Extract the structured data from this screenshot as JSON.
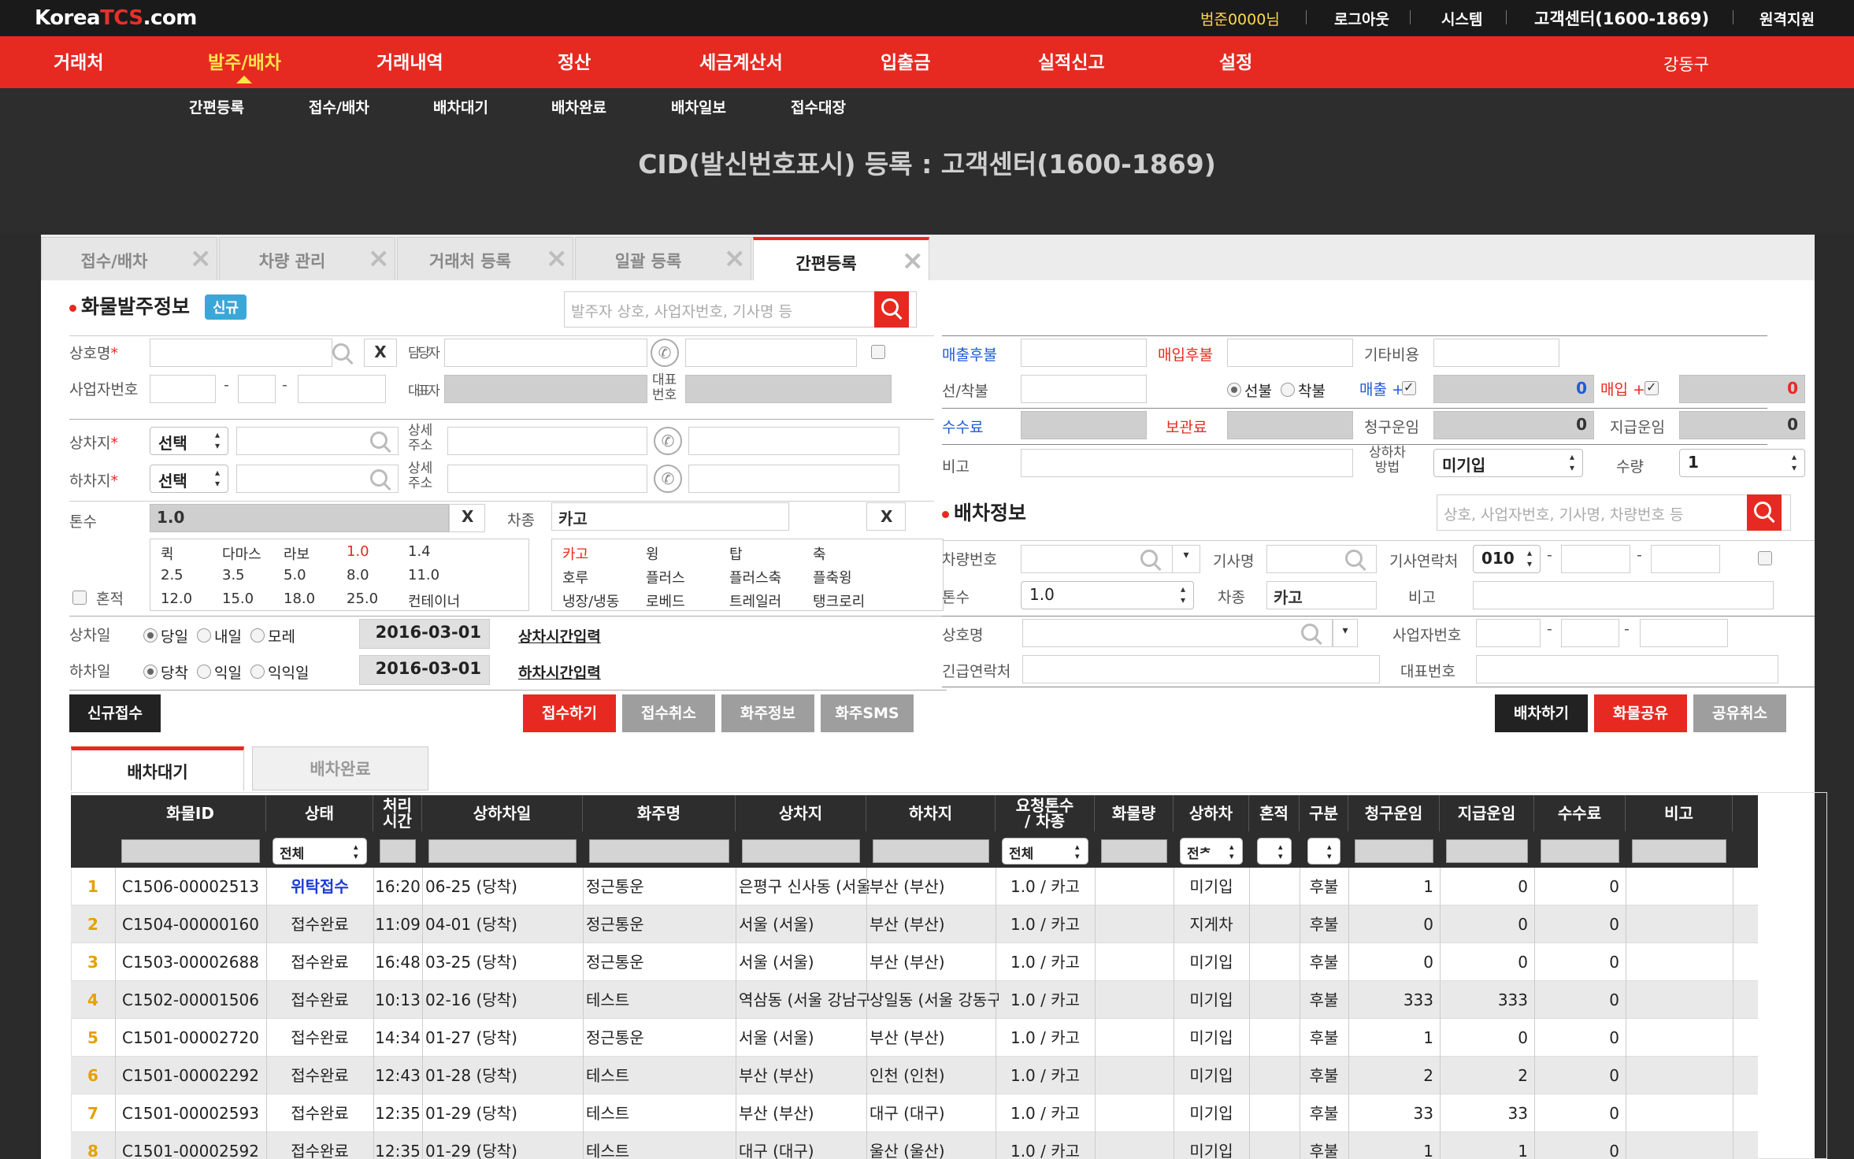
{
  "topbar": {
    "logo_prefix": "Korea",
    "logo_tcs": "TCS",
    "logo_suffix": ".com",
    "user": "범준0000님",
    "logout": "로그아웃",
    "system": "시스템",
    "support_center": "고객센터(1600-1869)",
    "remote": "원격지원"
  },
  "nav": {
    "items": [
      "거래처",
      "발주/배차",
      "거래내역",
      "정산",
      "세금계산서",
      "입출금",
      "실적신고",
      "설정"
    ],
    "region": "강동구"
  },
  "subnav": {
    "items": [
      "간편등록",
      "접수/배차",
      "배차대기",
      "배차완료",
      "배차일보",
      "접수대장"
    ],
    "page_title": "CID(발신번호표시) 등록 : 고객센터(1600-1869)"
  },
  "tabs": [
    {
      "label": "접수/배차"
    },
    {
      "label": "차량 관리"
    },
    {
      "label": "거래처 등록"
    },
    {
      "label": "일괄 등록"
    },
    {
      "label": "간편등록"
    }
  ],
  "order": {
    "title": "화물발주정보",
    "badge": "신규",
    "search_placeholder": "발주자 상호, 사업자번호, 기사명 등",
    "company_label": "상호명",
    "manager_label": "담당자",
    "bizno_label": "사업자번호",
    "ceo_label": "대표자",
    "rep_no_label": "대표\n번호",
    "load_label": "상차지",
    "unload_label": "하차지",
    "select": "선택",
    "detail_addr_label": "상세\n주소",
    "tonnage_label": "톤수",
    "tonnage_value": "1.0",
    "vehicle_label": "차종",
    "vehicle_value": "카고",
    "mixed_label": "혼적",
    "tonnage_options": [
      [
        "퀵",
        "다마스",
        "라보",
        "1.0",
        "1.4"
      ],
      [
        "2.5",
        "3.5",
        "5.0",
        "8.0",
        "11.0"
      ],
      [
        "12.0",
        "15.0",
        "18.0",
        "25.0",
        "컨테이너"
      ]
    ],
    "vehicle_options": [
      [
        "카고",
        "윙",
        "탑",
        "축"
      ],
      [
        "호루",
        "플러스",
        "플러스축",
        "플축윙"
      ],
      [
        "냉장/냉동",
        "로베드",
        "트레일러",
        "탱크로리"
      ]
    ],
    "load_date_label": "상차일",
    "load_day_options": [
      "당일",
      "내일",
      "모레"
    ],
    "load_date": "2016-03-01",
    "load_time_link": "상차시간입력",
    "unload_date_label": "하차일",
    "unload_day_options": [
      "당착",
      "익일",
      "익익일"
    ],
    "unload_date": "2016-03-01",
    "unload_time_link": "하차시간입력",
    "x": "X",
    "buttons": {
      "new": "신규접수",
      "submit": "접수하기",
      "cancel": "접수취소",
      "shipper_info": "화주정보",
      "shipper_sms": "화주SMS"
    }
  },
  "billing": {
    "sales_deferred": "매출후불",
    "purchase_deferred": "매입후불",
    "other_cost": "기타비용",
    "prepaid_label": "선/착불",
    "prepaid": "선불",
    "collect": "착불",
    "sales_plus": "매출 +",
    "sales_value": "0",
    "purchase_plus": "매입 +",
    "purchase_value": "0",
    "fee": "수수료",
    "storage_fee": "보관료",
    "claim_fare": "청구운임",
    "claim_value": "0",
    "pay_fare": "지급운임",
    "pay_value": "0",
    "note": "비고",
    "loading_method": "상하차\n방법",
    "loading_method_value": "미기입",
    "quantity": "수량",
    "quantity_value": "1"
  },
  "dispatch": {
    "title": "배차정보",
    "search_placeholder": "상호, 사업자번호, 기사명, 차량번호 등",
    "vehicle_no": "차량번호",
    "driver_name": "기사명",
    "driver_contact": "기사연락처",
    "phone_prefix": "010",
    "tonnage": "톤수",
    "tonnage_value": "1.0",
    "vehicle_type": "차종",
    "vehicle_value": "카고",
    "note": "비고",
    "company": "상호명",
    "bizno": "사업자번호",
    "emergency": "긴급연락처",
    "rep_no": "대표번호",
    "buttons": {
      "dispatch": "배차하기",
      "share": "화물공유",
      "unshare": "공유취소"
    }
  },
  "list": {
    "tabs": [
      "배차대기",
      "배차완료"
    ],
    "headers": [
      "화물ID",
      "상태",
      "처리\n시간",
      "상하차일",
      "화주명",
      "상차지",
      "하차지",
      "요청톤수\n/ 차종",
      "화물량",
      "상하차",
      "혼적",
      "구분",
      "청구운임",
      "지급운임",
      "수수료",
      "비고"
    ],
    "filter_all": "전체",
    "filter_all_short": "전ᅔ",
    "rows": [
      {
        "no": "1",
        "id": "C1506-00002513",
        "status": "위탁접수",
        "time": "16:20",
        "date": "06-25 (당착)",
        "shipper": "정근통운",
        "from": "은평구 신사동 (서울",
        "to": "부산 (부산)",
        "ton": "1.0 / 카고",
        "qty": "",
        "method": "미기입",
        "mixed": "",
        "type": "후불",
        "claim": "1",
        "pay": "0",
        "fee": "0",
        "note": ""
      },
      {
        "no": "2",
        "id": "C1504-00000160",
        "status": "접수완료",
        "time": "11:09",
        "date": "04-01 (당착)",
        "shipper": "정근통운",
        "from": "서울 (서울)",
        "to": "부산 (부산)",
        "ton": "1.0 / 카고",
        "qty": "",
        "method": "지게차",
        "mixed": "",
        "type": "후불",
        "claim": "0",
        "pay": "0",
        "fee": "0",
        "note": ""
      },
      {
        "no": "3",
        "id": "C1503-00002688",
        "status": "접수완료",
        "time": "16:48",
        "date": "03-25 (당착)",
        "shipper": "정근통운",
        "from": "서울 (서울)",
        "to": "부산 (부산)",
        "ton": "1.0 / 카고",
        "qty": "",
        "method": "미기입",
        "mixed": "",
        "type": "후불",
        "claim": "0",
        "pay": "0",
        "fee": "0",
        "note": ""
      },
      {
        "no": "4",
        "id": "C1502-00001506",
        "status": "접수완료",
        "time": "10:13",
        "date": "02-16 (당착)",
        "shipper": "테스트",
        "from": "역삼동 (서울 강남구",
        "to": "상일동 (서울 강동구",
        "ton": "1.0 / 카고",
        "qty": "",
        "method": "미기입",
        "mixed": "",
        "type": "후불",
        "claim": "333",
        "pay": "333",
        "fee": "0",
        "note": ""
      },
      {
        "no": "5",
        "id": "C1501-00002720",
        "status": "접수완료",
        "time": "14:34",
        "date": "01-27 (당착)",
        "shipper": "정근통운",
        "from": "서울 (서울)",
        "to": "부산 (부산)",
        "ton": "1.0 / 카고",
        "qty": "",
        "method": "미기입",
        "mixed": "",
        "type": "후불",
        "claim": "1",
        "pay": "0",
        "fee": "0",
        "note": ""
      },
      {
        "no": "6",
        "id": "C1501-00002292",
        "status": "접수완료",
        "time": "12:43",
        "date": "01-28 (당착)",
        "shipper": "테스트",
        "from": "부산 (부산)",
        "to": "인천 (인천)",
        "ton": "1.0 / 카고",
        "qty": "",
        "method": "미기입",
        "mixed": "",
        "type": "후불",
        "claim": "2",
        "pay": "2",
        "fee": "0",
        "note": ""
      },
      {
        "no": "7",
        "id": "C1501-00002593",
        "status": "접수완료",
        "time": "12:35",
        "date": "01-29 (당착)",
        "shipper": "테스트",
        "from": "부산 (부산)",
        "to": "대구 (대구)",
        "ton": "1.0 / 카고",
        "qty": "",
        "method": "미기입",
        "mixed": "",
        "type": "후불",
        "claim": "33",
        "pay": "33",
        "fee": "0",
        "note": ""
      },
      {
        "no": "8",
        "id": "C1501-00002592",
        "status": "접수완료",
        "time": "12:35",
        "date": "01-29 (당착)",
        "shipper": "테스트",
        "from": "대구 (대구)",
        "to": "울산 (울산)",
        "ton": "1.0 / 카고",
        "qty": "",
        "method": "미기입",
        "mixed": "",
        "type": "후불",
        "claim": "1",
        "pay": "1",
        "fee": "0",
        "note": ""
      }
    ]
  }
}
